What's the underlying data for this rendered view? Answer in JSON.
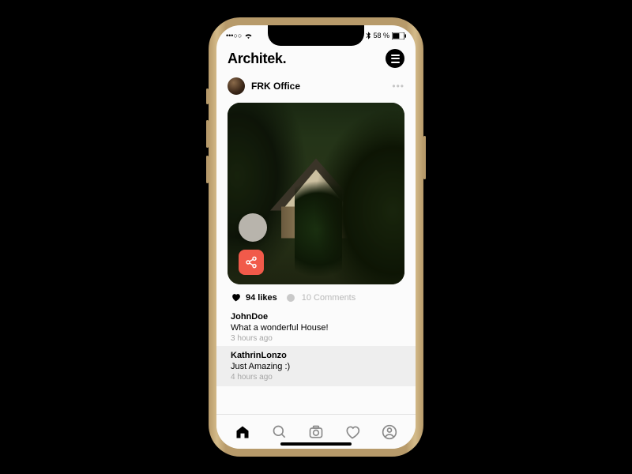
{
  "statusbar": {
    "signal": "•••○○",
    "wifi": "wifi",
    "bluetooth": "bt",
    "battery_pct": "58 %"
  },
  "header": {
    "title": "Architek."
  },
  "post": {
    "username": "FRK Office",
    "likes_label": "94 likes",
    "comments_label": "10 Comments"
  },
  "comments": [
    {
      "user": "JohnDoe",
      "text": "What a wonderful House!",
      "time": "3 hours ago"
    },
    {
      "user": "KathrinLonzo",
      "text": "Just Amazing :)",
      "time": "4 hours ago"
    }
  ],
  "tabs": [
    "home",
    "search",
    "camera",
    "likes",
    "profile"
  ]
}
